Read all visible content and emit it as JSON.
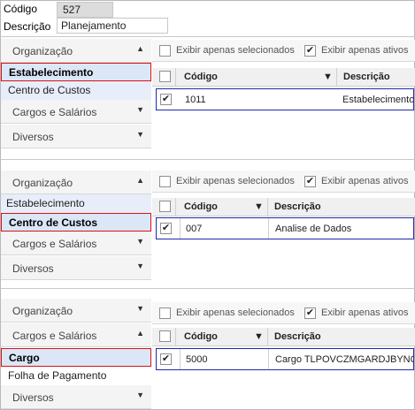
{
  "form": {
    "codigo_label": "Código",
    "codigo_value": "527",
    "descricao_label": "Descrição",
    "descricao_value": "Planejamento"
  },
  "filters": {
    "only_selected_label": "Exibir apenas selecionados",
    "only_active_label": "Exibir apenas ativos"
  },
  "grid_headers": {
    "codigo": "Código",
    "descricao": "Descrição"
  },
  "check_glyph": "✔",
  "sections": [
    {
      "accordion": {
        "organizacao": "Organização",
        "subitems": [
          "Estabelecimento",
          "Centro de Custos"
        ],
        "cargos": "Cargos e Salários",
        "diversos": "Diversos"
      },
      "row": {
        "codigo": "1011",
        "descricao": "Estabelecimento"
      }
    },
    {
      "accordion": {
        "organizacao": "Organização",
        "subitems": [
          "Estabelecimento",
          "Centro de Custos"
        ],
        "cargos": "Cargos e Salários",
        "diversos": "Diversos"
      },
      "row": {
        "codigo": "007",
        "descricao": "Analise de Dados"
      }
    },
    {
      "accordion": {
        "organizacao": "Organização",
        "cargos": "Cargos e Salários",
        "subitems": [
          "Cargo",
          "Folha de Pagamento"
        ],
        "diversos": "Diversos"
      },
      "row": {
        "codigo": "5000",
        "descricao": "Cargo TLPOVCZMGARDJBYNQ"
      }
    }
  ]
}
